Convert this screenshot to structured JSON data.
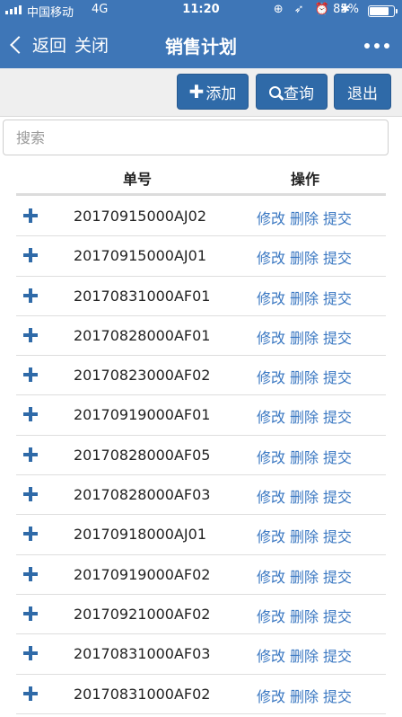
{
  "status_bar": {
    "carrier": "中国移动",
    "network": "4G",
    "time": "11:20",
    "icons": "⊕ ➶ ⏰ ✱",
    "battery_percent": "85%",
    "battery_level": 0.85
  },
  "nav": {
    "back_label": "返回",
    "close_label": "关闭",
    "title": "销售计划",
    "more_icon": "more-dots-icon"
  },
  "toolbar": {
    "add_label": "添加",
    "query_label": "查询",
    "exit_label": "退出"
  },
  "search": {
    "placeholder": "搜索"
  },
  "table": {
    "headers": {
      "number": "单号",
      "actions": "操作"
    },
    "action_labels": {
      "edit": "修改",
      "delete": "删除",
      "submit": "提交"
    },
    "rows": [
      {
        "number": "20170915000AJ02"
      },
      {
        "number": "20170915000AJ01"
      },
      {
        "number": "20170831000AF01"
      },
      {
        "number": "20170828000AF01"
      },
      {
        "number": "20170823000AF02"
      },
      {
        "number": "20170919000AF01"
      },
      {
        "number": "20170828000AF05"
      },
      {
        "number": "20170828000AF03"
      },
      {
        "number": "20170918000AJ01"
      },
      {
        "number": "20170919000AF02"
      },
      {
        "number": "20170921000AF02"
      },
      {
        "number": "20170831000AF03"
      },
      {
        "number": "20170831000AF02"
      }
    ]
  },
  "colors": {
    "header_bg": "#3e76b7",
    "button_bg": "#2f6aa8",
    "link": "#3b78c2"
  }
}
